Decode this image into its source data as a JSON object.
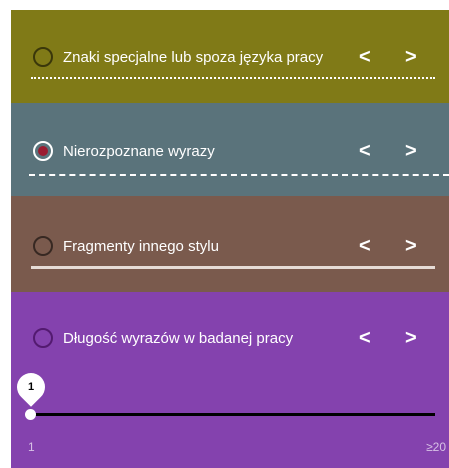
{
  "panels": [
    {
      "label": "Znaki specjalne lub spoza języka pracy",
      "selected": false,
      "color": "#807a17"
    },
    {
      "label": "Nierozpoznane wyrazy",
      "selected": true,
      "color": "#5a737b"
    },
    {
      "label": "Fragmenty innego stylu",
      "selected": false,
      "color": "#7a5a4d"
    },
    {
      "label": "Długość wyrazów w badanej pracy",
      "selected": false,
      "color": "#8442ae"
    }
  ],
  "nav": {
    "prev": "<",
    "next": ">"
  },
  "slider": {
    "value": "1",
    "min_label": "1",
    "max_label": "≥20",
    "level": 0
  },
  "colors": {
    "selected_radio": "#9b1b30"
  }
}
